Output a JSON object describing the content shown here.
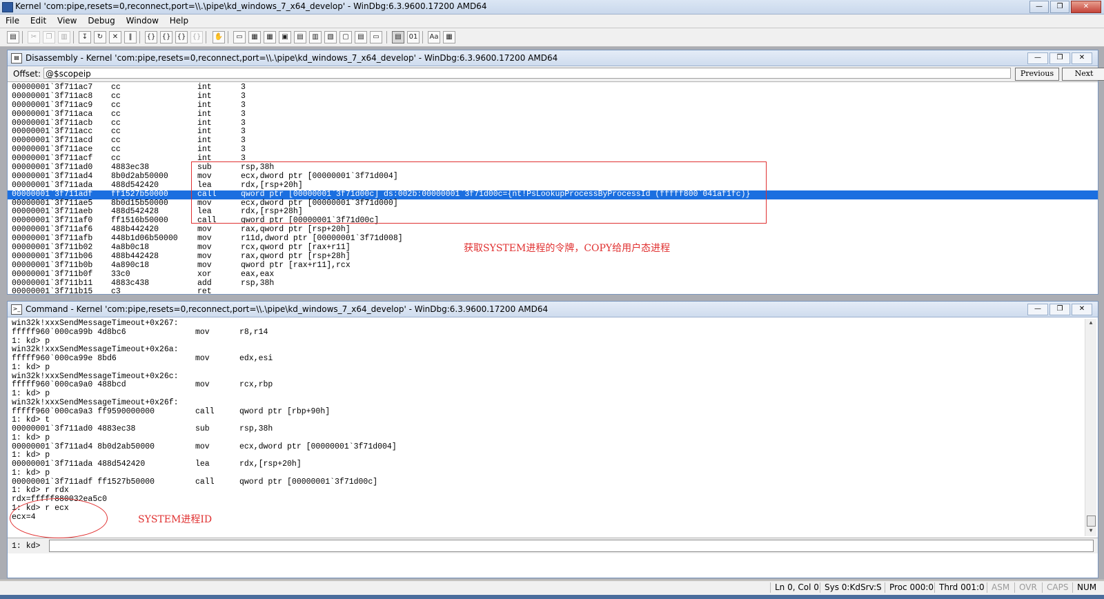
{
  "app": {
    "title": "Kernel 'com:pipe,resets=0,reconnect,port=\\\\.\\pipe\\kd_windows_7_x64_develop' - WinDbg:6.3.9600.17200 AMD64",
    "window_buttons": [
      "—",
      "❐",
      "✕"
    ]
  },
  "menu": [
    "File",
    "Edit",
    "View",
    "Debug",
    "Window",
    "Help"
  ],
  "disassembly": {
    "title": "Disassembly - Kernel 'com:pipe,resets=0,reconnect,port=\\\\.\\pipe\\kd_windows_7_x64_develop' - WinDbg:6.3.9600.17200 AMD64",
    "offset_label": "Offset:",
    "offset_value": "@$scopeip",
    "previous_label": "Previous",
    "next_label": "Next",
    "rows": [
      {
        "addr": "00000001`3f711ac7",
        "bytes": "cc",
        "op": "int",
        "args": "3"
      },
      {
        "addr": "00000001`3f711ac8",
        "bytes": "cc",
        "op": "int",
        "args": "3"
      },
      {
        "addr": "00000001`3f711ac9",
        "bytes": "cc",
        "op": "int",
        "args": "3"
      },
      {
        "addr": "00000001`3f711aca",
        "bytes": "cc",
        "op": "int",
        "args": "3"
      },
      {
        "addr": "00000001`3f711acb",
        "bytes": "cc",
        "op": "int",
        "args": "3"
      },
      {
        "addr": "00000001`3f711acc",
        "bytes": "cc",
        "op": "int",
        "args": "3"
      },
      {
        "addr": "00000001`3f711acd",
        "bytes": "cc",
        "op": "int",
        "args": "3"
      },
      {
        "addr": "00000001`3f711ace",
        "bytes": "cc",
        "op": "int",
        "args": "3"
      },
      {
        "addr": "00000001`3f711acf",
        "bytes": "cc",
        "op": "int",
        "args": "3"
      },
      {
        "addr": "00000001`3f711ad0",
        "bytes": "4883ec38",
        "op": "sub",
        "args": "rsp,38h"
      },
      {
        "addr": "00000001`3f711ad4",
        "bytes": "8b0d2ab50000",
        "op": "mov",
        "args": "ecx,dword ptr [00000001`3f71d004]"
      },
      {
        "addr": "00000001`3f711ada",
        "bytes": "488d542420",
        "op": "lea",
        "args": "rdx,[rsp+20h]"
      },
      {
        "addr": "00000001`3f711adf",
        "bytes": "ff1527b50000",
        "op": "call",
        "args": "qword ptr [00000001`3f71d00c] ds:002b:00000001`3f71d00c={nt!PsLookupProcessByProcessId (fffff800`041af1fc)}"
      },
      {
        "addr": "00000001`3f711ae5",
        "bytes": "8b0d15b50000",
        "op": "mov",
        "args": "ecx,dword ptr [00000001`3f71d000]"
      },
      {
        "addr": "00000001`3f711aeb",
        "bytes": "488d542428",
        "op": "lea",
        "args": "rdx,[rsp+28h]"
      },
      {
        "addr": "00000001`3f711af0",
        "bytes": "ff1516b50000",
        "op": "call",
        "args": "qword ptr [00000001`3f71d00c]"
      },
      {
        "addr": "00000001`3f711af6",
        "bytes": "488b442420",
        "op": "mov",
        "args": "rax,qword ptr [rsp+20h]"
      },
      {
        "addr": "00000001`3f711afb",
        "bytes": "448b1d06b50000",
        "op": "mov",
        "args": "r11d,dword ptr [00000001`3f71d008]"
      },
      {
        "addr": "00000001`3f711b02",
        "bytes": "4a8b0c18",
        "op": "mov",
        "args": "rcx,qword ptr [rax+r11]"
      },
      {
        "addr": "00000001`3f711b06",
        "bytes": "488b442428",
        "op": "mov",
        "args": "rax,qword ptr [rsp+28h]"
      },
      {
        "addr": "00000001`3f711b0b",
        "bytes": "4a890c18",
        "op": "mov",
        "args": "qword ptr [rax+r11],rcx"
      },
      {
        "addr": "00000001`3f711b0f",
        "bytes": "33c0",
        "op": "xor",
        "args": "eax,eax"
      },
      {
        "addr": "00000001`3f711b11",
        "bytes": "4883c438",
        "op": "add",
        "args": "rsp,38h"
      },
      {
        "addr": "00000001`3f711b15",
        "bytes": "c3",
        "op": "ret",
        "args": ""
      }
    ],
    "highlight_index": 12,
    "annotation": "获取SYSTEM进程的令牌，COPY给用户态进程"
  },
  "command": {
    "title": "Command - Kernel 'com:pipe,resets=0,reconnect,port=\\\\.\\pipe\\kd_windows_7_x64_develop' - WinDbg:6.3.9600.17200 AMD64",
    "lines": [
      {
        "c1": "win32k!xxxSendMessageTimeout+0x267:",
        "c2": "",
        "c3": ""
      },
      {
        "c1": "fffff960`000ca99b 4d8bc6",
        "c2": "mov",
        "c3": "r8,r14"
      },
      {
        "c1": "1: kd> p",
        "c2": "",
        "c3": ""
      },
      {
        "c1": "win32k!xxxSendMessageTimeout+0x26a:",
        "c2": "",
        "c3": ""
      },
      {
        "c1": "fffff960`000ca99e 8bd6",
        "c2": "mov",
        "c3": "edx,esi"
      },
      {
        "c1": "1: kd> p",
        "c2": "",
        "c3": ""
      },
      {
        "c1": "win32k!xxxSendMessageTimeout+0x26c:",
        "c2": "",
        "c3": ""
      },
      {
        "c1": "fffff960`000ca9a0 488bcd",
        "c2": "mov",
        "c3": "rcx,rbp"
      },
      {
        "c1": "1: kd> p",
        "c2": "",
        "c3": ""
      },
      {
        "c1": "win32k!xxxSendMessageTimeout+0x26f:",
        "c2": "",
        "c3": ""
      },
      {
        "c1": "fffff960`000ca9a3 ff9590000000",
        "c2": "call",
        "c3": "qword ptr [rbp+90h]"
      },
      {
        "c1": "1: kd> t",
        "c2": "",
        "c3": ""
      },
      {
        "c1": "00000001`3f711ad0 4883ec38",
        "c2": "sub",
        "c3": "rsp,38h"
      },
      {
        "c1": "1: kd> p",
        "c2": "",
        "c3": ""
      },
      {
        "c1": "00000001`3f711ad4 8b0d2ab50000",
        "c2": "mov",
        "c3": "ecx,dword ptr [00000001`3f71d004]"
      },
      {
        "c1": "1: kd> p",
        "c2": "",
        "c3": ""
      },
      {
        "c1": "00000001`3f711ada 488d542420",
        "c2": "lea",
        "c3": "rdx,[rsp+20h]"
      },
      {
        "c1": "1: kd> p",
        "c2": "",
        "c3": ""
      },
      {
        "c1": "00000001`3f711adf ff1527b50000",
        "c2": "call",
        "c3": "qword ptr [00000001`3f71d00c]"
      },
      {
        "c1": "1: kd> r rdx",
        "c2": "",
        "c3": ""
      },
      {
        "c1": "rdx=fffff880032ea5c0",
        "c2": "",
        "c3": ""
      },
      {
        "c1": "1: kd> r ecx",
        "c2": "",
        "c3": ""
      },
      {
        "c1": "ecx=4",
        "c2": "",
        "c3": ""
      }
    ],
    "annotation": "SYSTEM进程ID",
    "prompt": "1: kd>",
    "input_value": ""
  },
  "status": {
    "ln_col": "Ln 0, Col 0",
    "sys": "Sys 0:KdSrv:S",
    "proc": "Proc 000:0",
    "thrd": "Thrd 001:0",
    "asm": "ASM",
    "ovr": "OVR",
    "caps": "CAPS",
    "num": "NUM"
  },
  "colors": {
    "highlight": "#1b6fe0",
    "annotation": "#e03030"
  }
}
